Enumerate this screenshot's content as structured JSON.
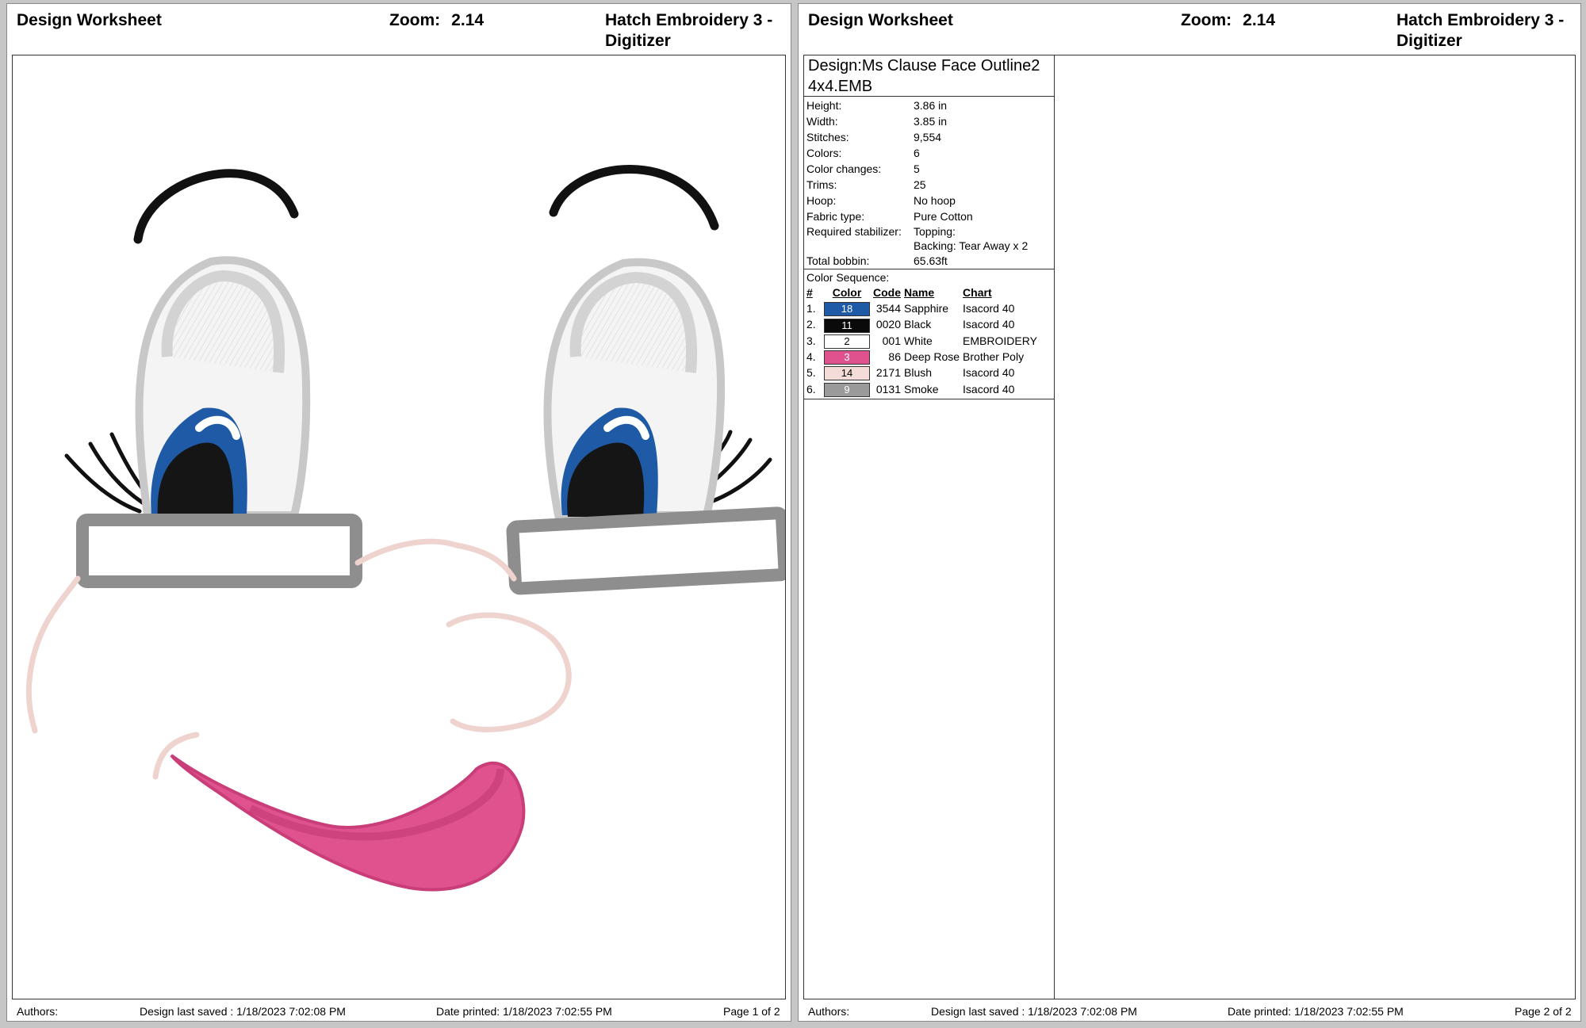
{
  "pages": [
    {
      "header": {
        "title": "Design Worksheet",
        "zoom_label": "Zoom:",
        "zoom_value": "2.14",
        "app": "Hatch Embroidery 3 - Digitizer"
      },
      "footer": {
        "authors": "Authors:",
        "saved": "Design last saved : 1/18/2023 7:02:08 PM",
        "printed": "Date printed: 1/18/2023 7:02:55 PM",
        "page": "Page 1 of 2"
      }
    },
    {
      "header": {
        "title": "Design Worksheet",
        "zoom_label": "Zoom:",
        "zoom_value": "2.14",
        "app": "Hatch Embroidery 3 - Digitizer"
      },
      "footer": {
        "authors": "Authors:",
        "saved": "Design last saved : 1/18/2023 7:02:08 PM",
        "printed": "Date printed: 1/18/2023 7:02:55 PM",
        "page": "Page 2 of 2"
      }
    }
  ],
  "design": {
    "name_prefix": "Design:",
    "name": "Ms Clause Face Outline2 4x4.EMB",
    "stats": [
      {
        "label": "Height:",
        "value": "3.86 in"
      },
      {
        "label": "Width:",
        "value": "3.85 in"
      },
      {
        "label": "Stitches:",
        "value": "9,554"
      },
      {
        "label": "Colors:",
        "value": "6"
      },
      {
        "label": "Color changes:",
        "value": "5"
      },
      {
        "label": "Trims:",
        "value": "25"
      },
      {
        "label": "Hoop:",
        "value": "No hoop"
      },
      {
        "label": "Fabric type:",
        "value": "Pure Cotton"
      }
    ],
    "stabilizer": {
      "label": "Required stabilizer:",
      "topping": "Topping:",
      "backing": "Backing: Tear Away x 2"
    },
    "bobbin": {
      "label": "Total bobbin:",
      "value": "65.63ft"
    }
  },
  "color_sequence": {
    "title": "Color Sequence:",
    "headers": {
      "num": "#",
      "color": "Color",
      "code": "Code",
      "name": "Name",
      "chart": "Chart"
    },
    "rows": [
      {
        "num": "1.",
        "swatch": "18",
        "hex": "#1f5aa6",
        "text_color": "#ffffff",
        "code": "3544",
        "name": "Sapphire",
        "chart": "Isacord 40"
      },
      {
        "num": "2.",
        "swatch": "11",
        "hex": "#0a0a0a",
        "text_color": "#ffffff",
        "code": "0020",
        "name": "Black",
        "chart": "Isacord 40"
      },
      {
        "num": "3.",
        "swatch": "2",
        "hex": "#ffffff",
        "text_color": "#000000",
        "code": "001",
        "name": "White",
        "chart": "EMBROIDERY"
      },
      {
        "num": "4.",
        "swatch": "3",
        "hex": "#e0528e",
        "text_color": "#ffffff",
        "code": "86",
        "name": "Deep Rose",
        "chart": "Brother Poly"
      },
      {
        "num": "5.",
        "swatch": "14",
        "hex": "#f4dcd8",
        "text_color": "#000000",
        "code": "2171",
        "name": "Blush",
        "chart": "Isacord 40"
      },
      {
        "num": "6.",
        "swatch": "9",
        "hex": "#9a9a9a",
        "text_color": "#ffffff",
        "code": "0131",
        "name": "Smoke",
        "chart": "Isacord 40"
      }
    ]
  }
}
